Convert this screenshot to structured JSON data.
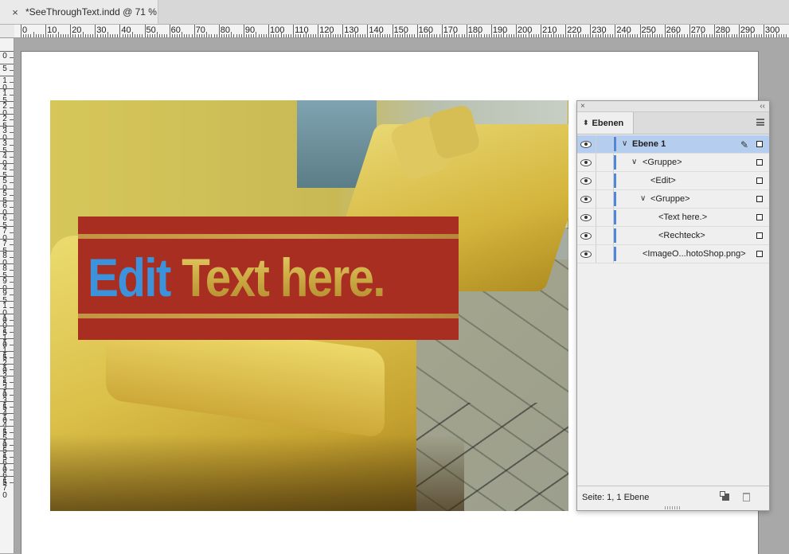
{
  "document_tab": {
    "close_glyph": "×",
    "title": "*SeeThroughText.indd @ 71 %"
  },
  "ruler_top": {
    "labels": [
      "0",
      "10",
      "20",
      "30",
      "40",
      "50",
      "60",
      "70",
      "80",
      "90",
      "100",
      "110",
      "120",
      "130",
      "140",
      "150",
      "160",
      "170",
      "180",
      "190",
      "200",
      "210",
      "220",
      "230",
      "240",
      "250",
      "260",
      "270",
      "280",
      "290",
      "300"
    ]
  },
  "ruler_left": {
    "labels": [
      "0",
      "5",
      "1\n0",
      "1\n5",
      "2\n0",
      "2\n5",
      "3\n0",
      "3\n5",
      "4\n0",
      "4\n5",
      "5\n0",
      "5\n5",
      "6\n0",
      "6\n5",
      "7\n0",
      "7\n5",
      "8\n0",
      "8\n5",
      "9\n0",
      "9\n5",
      "1\n0\n0",
      "1\n0\n5",
      "1\n1\n0",
      "1\n1\n5",
      "1\n2\n0",
      "1\n2\n5",
      "1\n3\n0",
      "1\n3\n5",
      "1\n4\n0",
      "1\n4\n5",
      "1\n5\n0",
      "1\n5\n5",
      "1\n6\n0",
      "1\n6\n5",
      "1\n7\n0"
    ]
  },
  "artwork": {
    "word_edit": "Edit",
    "word_rest": " Text here.",
    "edit_color": "#3c93dc",
    "banner_color": "#a92e22"
  },
  "layers_panel": {
    "close_glyph": "×",
    "collapse_glyph": "‹‹",
    "tab_label": "Ebenen",
    "rows": [
      {
        "label": "Ebene 1",
        "chevron": "∨",
        "selected": true
      },
      {
        "label": "<Gruppe>",
        "chevron": "∨"
      },
      {
        "label": "<Edit>",
        "chevron": ""
      },
      {
        "label": "<Gruppe>",
        "chevron": "∨"
      },
      {
        "label": "<Text here.>",
        "chevron": ""
      },
      {
        "label": "<Rechteck>",
        "chevron": ""
      },
      {
        "label": "<ImageO...hotoShop.png>",
        "chevron": ""
      }
    ],
    "status": "Seite: 1, 1 Ebene"
  }
}
